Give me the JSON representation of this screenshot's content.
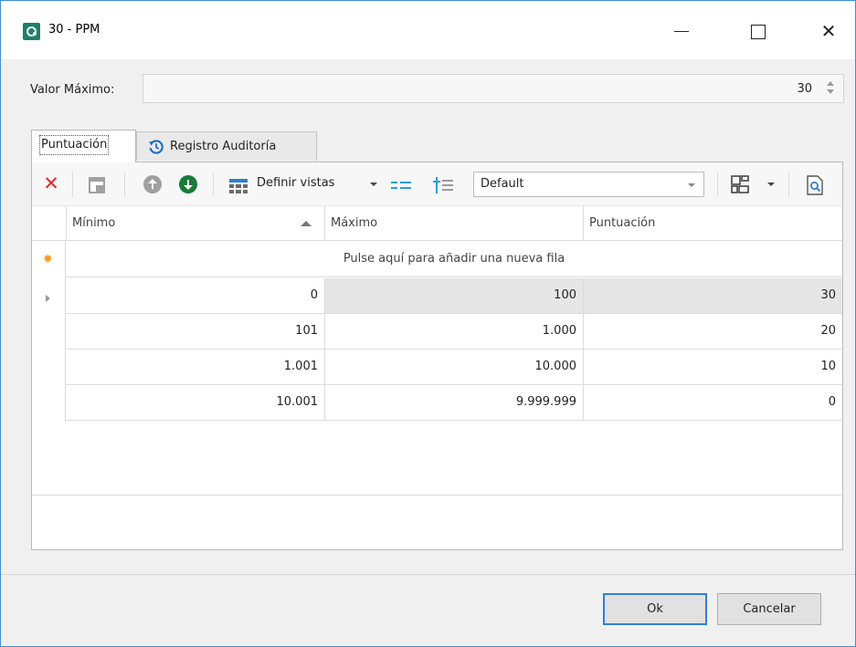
{
  "window": {
    "title": "30 - PPM"
  },
  "form": {
    "valor_label": "Valor Máximo:",
    "valor_value": "30"
  },
  "tabs": [
    {
      "label": "Puntuación",
      "active": true
    },
    {
      "label": "Registro Auditoría",
      "active": false
    }
  ],
  "toolbar": {
    "views_label": "Definir vistas",
    "view_selected": "Default"
  },
  "grid": {
    "columns": [
      "Mínimo",
      "Máximo",
      "Puntuación"
    ],
    "new_row_text": "Pulse aquí para añadir una nueva fila",
    "rows": [
      [
        "0",
        "100",
        "30"
      ],
      [
        "101",
        "1.000",
        "20"
      ],
      [
        "1.001",
        "10.000",
        "10"
      ],
      [
        "10.001",
        "9.999.999",
        "0"
      ]
    ]
  },
  "footer": {
    "ok_label": "Ok",
    "cancel_label": "Cancelar"
  },
  "colors": {
    "accent": "#2f7fd6",
    "delete": "#e02b2b",
    "move_down": "#1a7a3a",
    "app_icon": "#1e7f6a",
    "new_row_star": "#f29d2b"
  }
}
